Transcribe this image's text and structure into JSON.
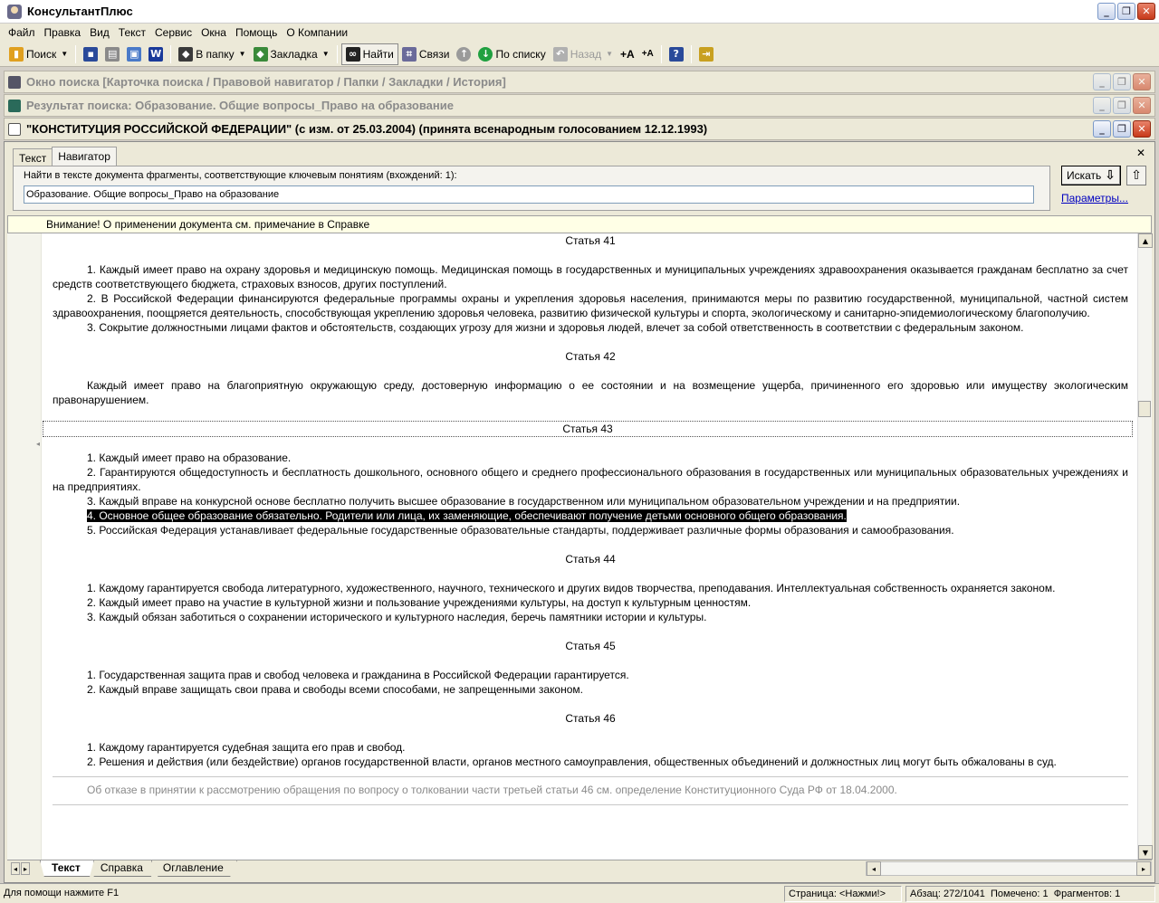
{
  "app": {
    "title": "КонсультантПлюс"
  },
  "menu": [
    "Файл",
    "Правка",
    "Вид",
    "Текст",
    "Сервис",
    "Окна",
    "Помощь",
    "О Компании"
  ],
  "toolbar": {
    "search": "Поиск",
    "to_folder": "В папку",
    "bookmark": "Закладка",
    "find": "Найти",
    "links": "Связи",
    "by_list": "По списку",
    "back": "Назад",
    "font_up": "+A",
    "font_down": "+A"
  },
  "windows": {
    "search_window": "Окно поиска [Карточка поиска / Правовой навигатор / Папки / Закладки / История]",
    "result_window": "Результат поиска: Образование. Общие вопросы_Право на образование",
    "doc_window": "\"КОНСТИТУЦИЯ РОССИЙСКОЙ ФЕДЕРАЦИИ\" (с изм. от 25.03.2004) (принята всенародным голосованием 12.12.1993)"
  },
  "panel": {
    "tabs": [
      "Текст",
      "Навигатор"
    ],
    "search_label": "Найти в тексте документа фрагменты, соответствующие ключевым понятиям (вхождений: 1):",
    "search_value": "Образование. Общие вопросы_Право на образование",
    "find_button": "Искать",
    "params_link": "Параметры..."
  },
  "warning": "Внимание! О применении документа см. примечание в Справке",
  "document": {
    "art41": "Статья 41",
    "a41p1": "1. Каждый имеет право на охрану здоровья и медицинскую помощь. Медицинская помощь в государственных и муниципальных учреждениях здравоохранения оказывается гражданам бесплатно за счет средств соответствующего бюджета, страховых взносов, других поступлений.",
    "a41p2": "2. В Российской Федерации финансируются федеральные программы охраны и укрепления здоровья населения, принимаются меры по развитию государственной, муниципальной, частной систем здравоохранения, поощряется деятельность, способствующая укреплению здоровья человека, развитию физической культуры и спорта, экологическому и санитарно-эпидемиологическому благополучию.",
    "a41p3": "3. Сокрытие должностными лицами фактов и обстоятельств, создающих угрозу для жизни и здоровья людей, влечет за собой ответственность в соответствии с федеральным законом.",
    "art42": "Статья 42",
    "a42p1": "Каждый имеет право на благоприятную окружающую среду, достоверную информацию о ее состоянии и на возмещение ущерба, причиненного его здоровью или имуществу экологическим правонарушением.",
    "art43": "Статья 43",
    "a43p1": "1. Каждый имеет право на образование.",
    "a43p2": "2. Гарантируются общедоступность и бесплатность дошкольного, основного общего и среднего профессионального образования в государственных или муниципальных образовательных учреждениях и на предприятиях.",
    "a43p3": "3. Каждый вправе на конкурсной основе бесплатно получить высшее образование в государственном или муниципальном образовательном учреждении и на предприятии.",
    "a43p4": "4. Основное общее образование обязательно. Родители или лица, их заменяющие, обеспечивают получение детьми основного общего образования.",
    "a43p5": "5. Российская Федерация устанавливает федеральные государственные образовательные стандарты, поддерживает различные формы образования и самообразования.",
    "art44": "Статья 44",
    "a44p1": "1. Каждому гарантируется свобода литературного, художественного, научного, технического и других видов творчества, преподавания. Интеллектуальная собственность охраняется законом.",
    "a44p2": "2. Каждый имеет право на участие в культурной жизни и пользование учреждениями культуры, на доступ к культурным ценностям.",
    "a44p3": "3. Каждый обязан заботиться о сохранении исторического и культурного наследия, беречь памятники истории и культуры.",
    "art45": "Статья 45",
    "a45p1": "1. Государственная защита прав и свобод человека и гражданина в Российской Федерации гарантируется.",
    "a45p2": "2. Каждый вправе защищать свои права и свободы всеми способами, не запрещенными законом.",
    "art46": "Статья 46",
    "a46p1": "1. Каждому гарантируется судебная защита его прав и свобод.",
    "a46p2": "2. Решения и действия (или бездействие) органов государственной власти, органов местного самоуправления, общественных объединений и должностных лиц могут быть обжалованы в суд.",
    "note": "Об отказе в принятии к рассмотрению обращения по вопросу о толковании части третьей статьи 46 см. определение Конституционного Суда РФ от 18.04.2000."
  },
  "bottom_tabs": [
    "Текст",
    "Справка",
    "Оглавление"
  ],
  "status": {
    "help": "Для помощи нажмите F1",
    "page": "Страница: <Нажми!>",
    "paragraph": "Абзац: 272/1041",
    "marked": "Помечено: 1",
    "fragments": "Фрагментов: 1"
  }
}
